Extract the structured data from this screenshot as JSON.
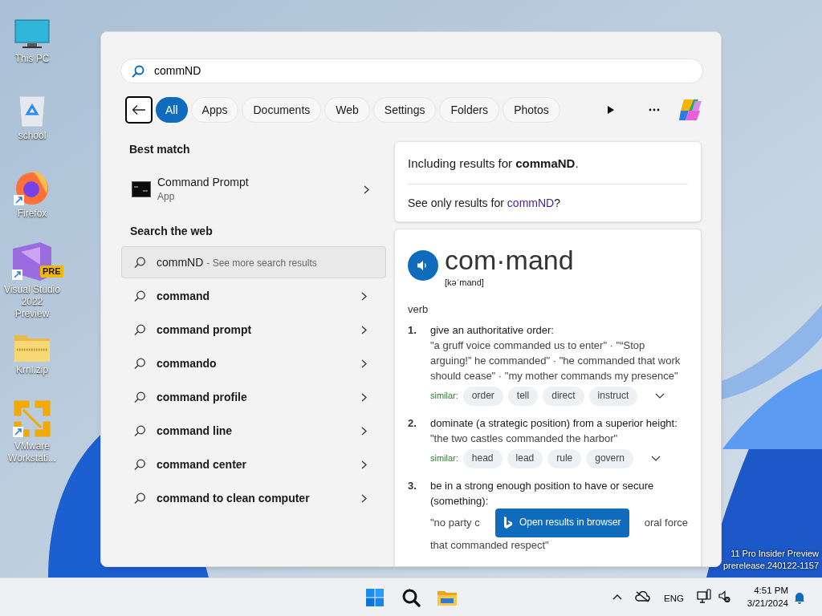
{
  "desktop_icons": [
    {
      "kind": "pc",
      "label": "This PC"
    },
    {
      "kind": "recycle",
      "label": "school"
    },
    {
      "kind": "firefox",
      "label": "Firefox"
    },
    {
      "kind": "vs",
      "label": "Visual Studio 2022 Preview",
      "badge": "PRE"
    },
    {
      "kind": "zip",
      "label": "Krnl.zip"
    },
    {
      "kind": "vmware",
      "label": "VMware Workstati..."
    }
  ],
  "search": {
    "query": "commND"
  },
  "filters": [
    {
      "label": "All",
      "selected": true
    },
    {
      "label": "Apps",
      "selected": false
    },
    {
      "label": "Documents",
      "selected": false
    },
    {
      "label": "Web",
      "selected": false
    },
    {
      "label": "Settings",
      "selected": false
    },
    {
      "label": "Folders",
      "selected": false
    },
    {
      "label": "Photos",
      "selected": false
    }
  ],
  "best_match": {
    "heading": "Best match",
    "title": "Command Prompt",
    "subtitle": "App"
  },
  "web_search": {
    "heading": "Search the web",
    "items": [
      {
        "query": "commND",
        "suffix": "- See more search results",
        "selected": true
      },
      {
        "query": "command",
        "selected": false
      },
      {
        "query": "command prompt",
        "selected": false
      },
      {
        "query": "commando",
        "selected": false
      },
      {
        "query": "command profile",
        "selected": false
      },
      {
        "query": "command line",
        "selected": false
      },
      {
        "query": "command center",
        "selected": false
      },
      {
        "query": "command to clean computer",
        "selected": false
      }
    ]
  },
  "spelling": {
    "including": "Including results for **commaND**.",
    "see_only_prefix": "See only results for",
    "see_only_link": "commND",
    "see_only_suffix": "?"
  },
  "dictionary": {
    "word": "com·mand",
    "pronunciation": "[kəˈmand]",
    "part_of_speech": "verb",
    "senses": [
      {
        "number": "1.",
        "definition": "give an authoritative order:",
        "examples": "\"a gruff voice commanded us to enter\" · \"“Stop arguing!” he commanded\" · \"he commanded that work should cease\" · \"my mother commands my presence\"",
        "similar_label": "similar:",
        "similar": [
          "order",
          "tell",
          "direct",
          "instruct"
        ]
      },
      {
        "number": "2.",
        "definition": "dominate (a strategic position) from a superior height:",
        "examples": "\"the two castles commanded the harbor\"",
        "similar_label": "similar:",
        "similar": [
          "head",
          "lead",
          "rule",
          "govern"
        ]
      },
      {
        "number": "3.",
        "definition": "be in a strong enough position to have or secure (something):",
        "covered_example": {
          "before": "\"no party c",
          "after": "oral force",
          "next_line": "that commanded respect\""
        }
      }
    ]
  },
  "open_button": "Open results in browser",
  "watermark": [
    "11 Pro Insider Preview",
    "prerelease.240122-1157"
  ],
  "taskbar": {
    "language": "ENG",
    "time": "4:51 PM",
    "date": "3/21/2024"
  }
}
